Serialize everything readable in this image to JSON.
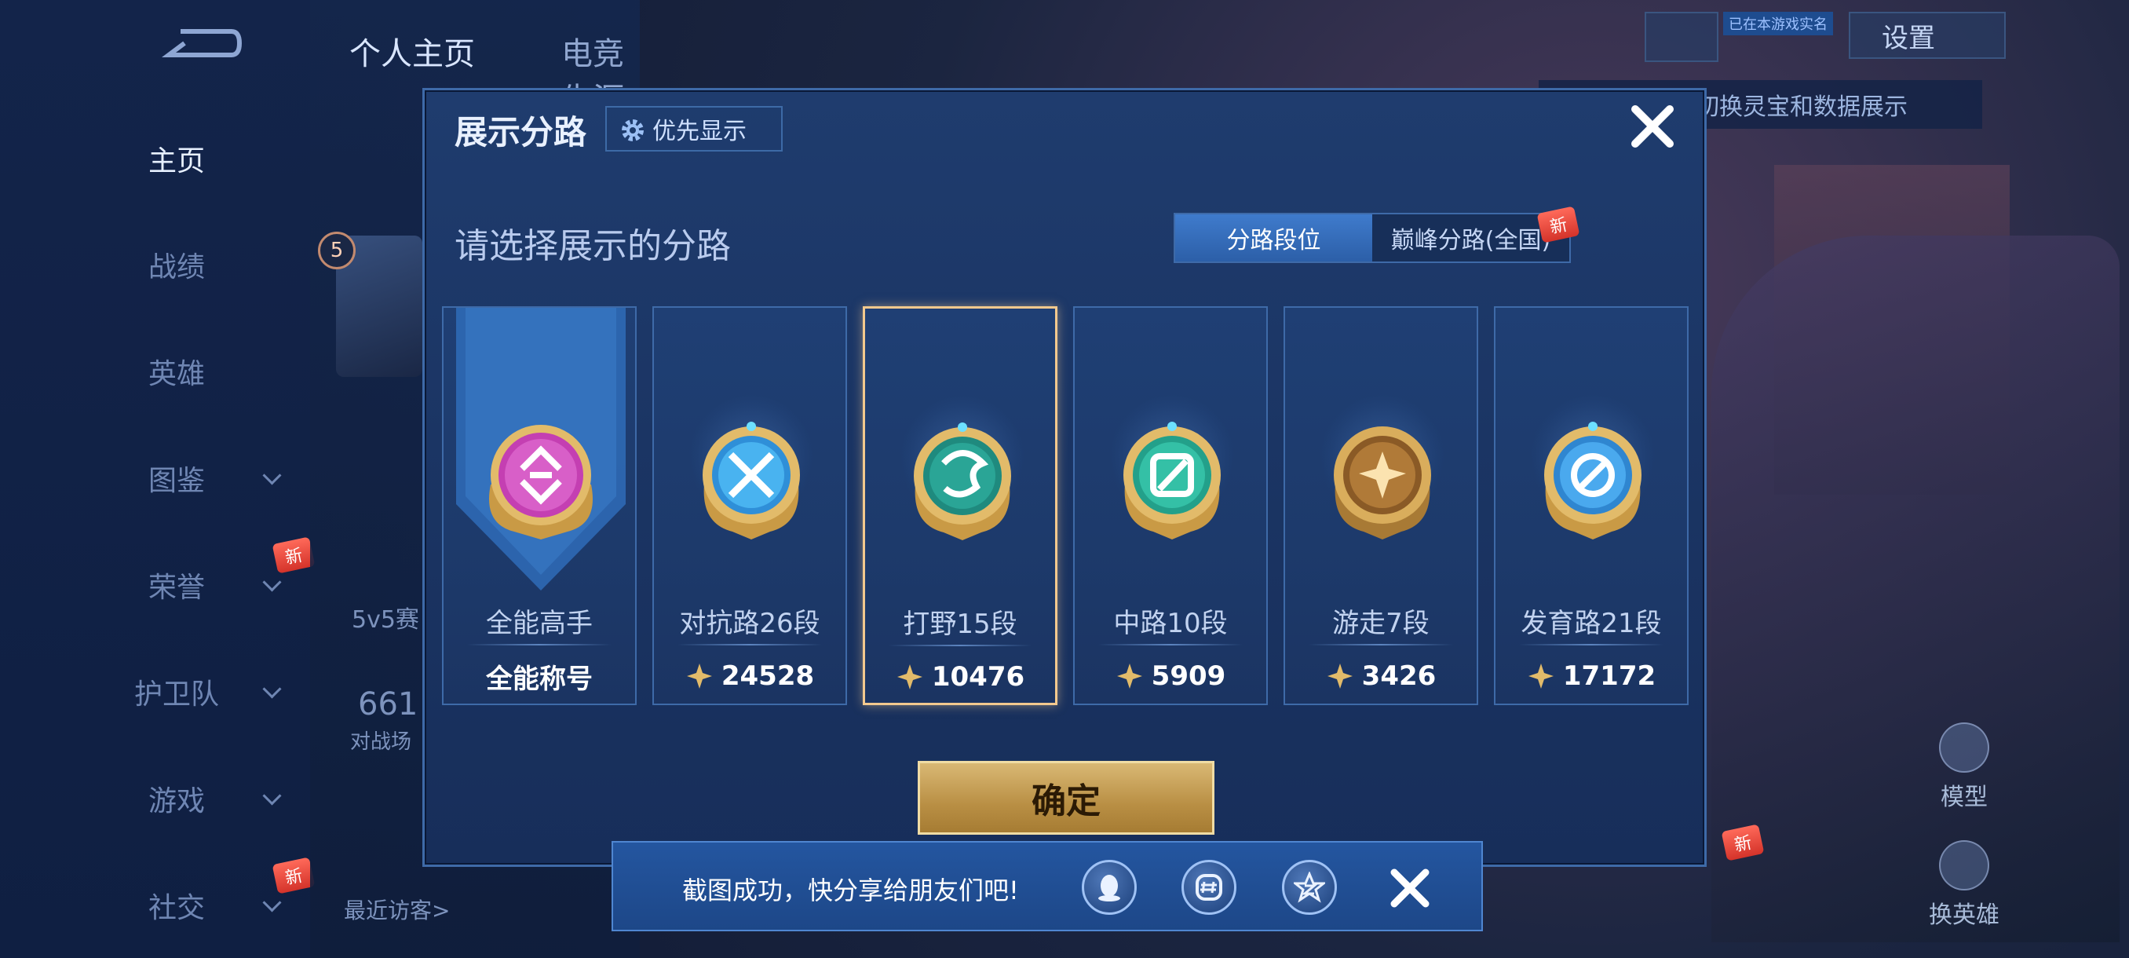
{
  "background": {
    "nav": {
      "items": [
        {
          "label": "主页"
        },
        {
          "label": "战绩"
        },
        {
          "label": "英雄"
        },
        {
          "label": "图鉴"
        },
        {
          "label": "荣誉"
        },
        {
          "label": "护卫队"
        },
        {
          "label": "游戏"
        },
        {
          "label": "社交"
        }
      ],
      "new_badge": "新"
    },
    "top_tabs": [
      "个人主页",
      "电竞生涯"
    ],
    "settings_label": "设置",
    "small_tag": "已在本游戏实名",
    "hint_text": "切换灵宝和数据展示",
    "side_buttons": [
      "模型",
      "换英雄"
    ],
    "level": "5",
    "mode_label": "5v5赛",
    "stat_number": "661",
    "stat_label": "对战场",
    "recent_visitors": "最近访客>"
  },
  "dialog": {
    "title": "展示分路",
    "priority_button": "优先显示",
    "subtitle": "请选择展示的分路",
    "segments": [
      "分路段位",
      "巅峰分路(全国)"
    ],
    "segment_new": "新",
    "selected_index": 2,
    "cards": [
      {
        "name": "全能高手",
        "value": "全能称号",
        "emblem": "all-round-emblem",
        "color": "#c43fb2"
      },
      {
        "name": "对抗路26段",
        "value": "24528",
        "emblem": "clash-lane-emblem",
        "color": "#2f8fd8"
      },
      {
        "name": "打野15段",
        "value": "10476",
        "emblem": "jungle-emblem",
        "color": "#1f8a7e"
      },
      {
        "name": "中路10段",
        "value": "5909",
        "emblem": "mid-lane-emblem",
        "color": "#23a08a"
      },
      {
        "name": "游走7段",
        "value": "3426",
        "emblem": "roam-emblem",
        "color": "#b07a38"
      },
      {
        "name": "发育路21段",
        "value": "17172",
        "emblem": "farm-lane-emblem",
        "color": "#2f86d0"
      }
    ],
    "confirm_label": "确定"
  },
  "share_bar": {
    "text": "截图成功，快分享给朋友们吧!",
    "icons": [
      "qq-icon",
      "wechat-moments-icon",
      "qzone-icon"
    ]
  },
  "colors": {
    "accent_gold": "#d9b874",
    "selected_border": "#f3c98e",
    "panel": "#1d3a6b"
  }
}
